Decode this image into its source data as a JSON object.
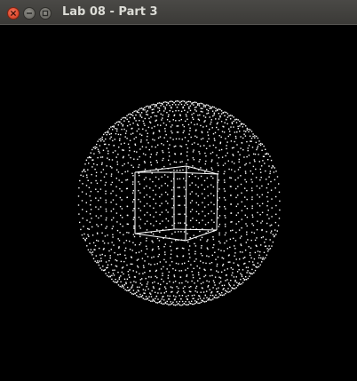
{
  "window": {
    "title": "Lab 08 - Part 3"
  },
  "controls": {
    "close_icon": "close-icon",
    "minimize_icon": "minimize-icon",
    "maximize_icon": "maximize-icon"
  },
  "scene": {
    "background_color": "#000000",
    "foreground_color": "#ffffff",
    "objects": [
      "point-sphere",
      "wireframe-cube"
    ]
  }
}
